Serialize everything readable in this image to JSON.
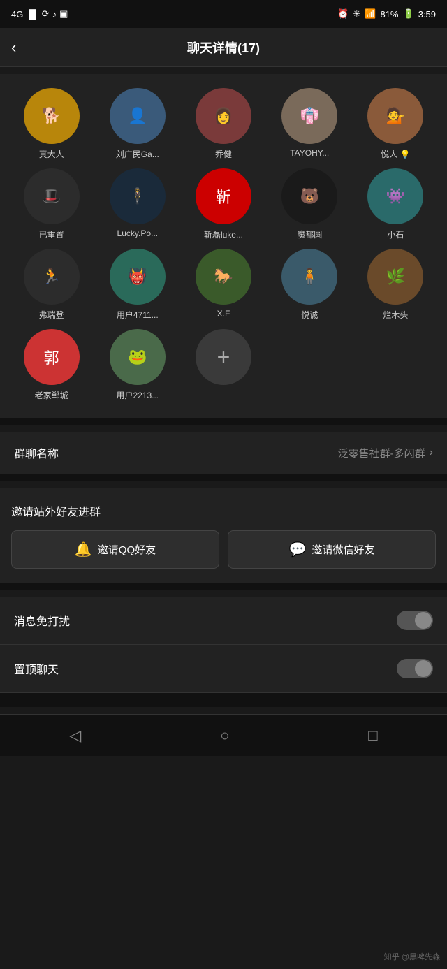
{
  "statusBar": {
    "signal": "4G",
    "time": "3:59",
    "battery": "81%",
    "icons": [
      "alarm",
      "bluetooth",
      "battery"
    ]
  },
  "navBar": {
    "title": "聊天详情(17)",
    "back": "‹"
  },
  "members": [
    {
      "name": "真大人",
      "emoji": "🐕",
      "bg": "#b8860b"
    },
    {
      "name": "刘广民Ga...",
      "emoji": "👤",
      "bg": "#3a5a7a"
    },
    {
      "name": "乔健",
      "emoji": "👩",
      "bg": "#7a3a3a"
    },
    {
      "name": "TAYOHY...",
      "emoji": "👘",
      "bg": "#7a6a5a"
    },
    {
      "name": "悦人 💡",
      "emoji": "💁",
      "bg": "#8a5a3a"
    },
    {
      "name": "已重置",
      "emoji": "🎩",
      "bg": "#2c2c2c"
    },
    {
      "name": "Lucky.Po...",
      "emoji": "🕴",
      "bg": "#1a2a3a"
    },
    {
      "name": "靳磊luke...",
      "emoji": "靳",
      "bg": "#cc0000"
    },
    {
      "name": "魔都圆",
      "emoji": "🐻",
      "bg": "#1a1a1a"
    },
    {
      "name": "小石",
      "emoji": "👾",
      "bg": "#2a6a6a"
    },
    {
      "name": "弗瑞登",
      "emoji": "🏃",
      "bg": "#2c2c2c"
    },
    {
      "name": "用户4711...",
      "emoji": "👹",
      "bg": "#2a6a5a"
    },
    {
      "name": "X.F",
      "emoji": "🐎",
      "bg": "#3a5a2a"
    },
    {
      "name": "悦诚",
      "emoji": "🧍",
      "bg": "#3a5a6a"
    },
    {
      "name": "烂木头",
      "emoji": "🌿",
      "bg": "#6a4a2a"
    },
    {
      "name": "老家郸城",
      "emoji": "郭",
      "bg": "#cc3333"
    },
    {
      "name": "用户2213...",
      "emoji": "🐸",
      "bg": "#4a6a4a"
    }
  ],
  "addButton": "+",
  "groupName": {
    "label": "群聊名称",
    "value": "泛零售社群-多闪群"
  },
  "inviteSection": {
    "title": "邀请站外好友进群",
    "qqButton": "邀请QQ好友",
    "wechatButton": "邀请微信好友",
    "qqIcon": "🔔",
    "wechatIcon": "💬"
  },
  "toggles": [
    {
      "label": "消息免打扰"
    },
    {
      "label": "置顶聊天"
    }
  ],
  "bottomNav": {
    "items": [
      "◁",
      "○",
      "□"
    ],
    "watermark": "知乎 @黑啤先森"
  }
}
